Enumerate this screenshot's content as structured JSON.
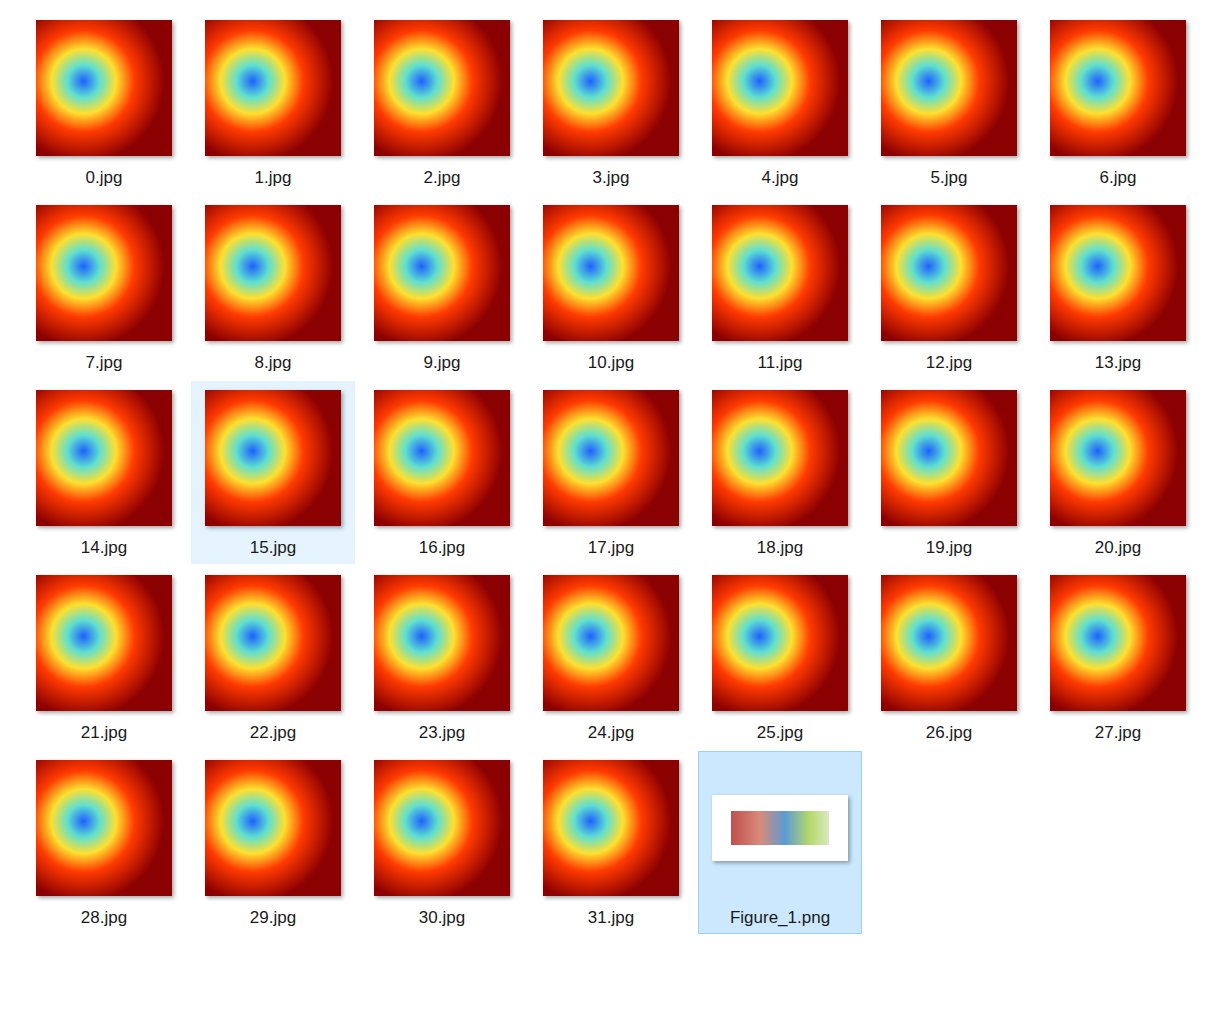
{
  "files": [
    {
      "name": "0.jpg",
      "kind": "image",
      "selected": false,
      "hovered": false
    },
    {
      "name": "1.jpg",
      "kind": "image",
      "selected": false,
      "hovered": false
    },
    {
      "name": "2.jpg",
      "kind": "image",
      "selected": false,
      "hovered": false
    },
    {
      "name": "3.jpg",
      "kind": "image",
      "selected": false,
      "hovered": false
    },
    {
      "name": "4.jpg",
      "kind": "image",
      "selected": false,
      "hovered": false
    },
    {
      "name": "5.jpg",
      "kind": "image",
      "selected": false,
      "hovered": false
    },
    {
      "name": "6.jpg",
      "kind": "image",
      "selected": false,
      "hovered": false
    },
    {
      "name": "7.jpg",
      "kind": "image",
      "selected": false,
      "hovered": false
    },
    {
      "name": "8.jpg",
      "kind": "image",
      "selected": false,
      "hovered": false
    },
    {
      "name": "9.jpg",
      "kind": "image",
      "selected": false,
      "hovered": false
    },
    {
      "name": "10.jpg",
      "kind": "image",
      "selected": false,
      "hovered": false
    },
    {
      "name": "11.jpg",
      "kind": "image",
      "selected": false,
      "hovered": false
    },
    {
      "name": "12.jpg",
      "kind": "image",
      "selected": false,
      "hovered": false
    },
    {
      "name": "13.jpg",
      "kind": "image",
      "selected": false,
      "hovered": false
    },
    {
      "name": "14.jpg",
      "kind": "image",
      "selected": false,
      "hovered": false
    },
    {
      "name": "15.jpg",
      "kind": "image",
      "selected": false,
      "hovered": true
    },
    {
      "name": "16.jpg",
      "kind": "image",
      "selected": false,
      "hovered": false
    },
    {
      "name": "17.jpg",
      "kind": "image",
      "selected": false,
      "hovered": false
    },
    {
      "name": "18.jpg",
      "kind": "image",
      "selected": false,
      "hovered": false
    },
    {
      "name": "19.jpg",
      "kind": "image",
      "selected": false,
      "hovered": false
    },
    {
      "name": "20.jpg",
      "kind": "image",
      "selected": false,
      "hovered": false
    },
    {
      "name": "21.jpg",
      "kind": "image",
      "selected": false,
      "hovered": false
    },
    {
      "name": "22.jpg",
      "kind": "image",
      "selected": false,
      "hovered": false
    },
    {
      "name": "23.jpg",
      "kind": "image",
      "selected": false,
      "hovered": false
    },
    {
      "name": "24.jpg",
      "kind": "image",
      "selected": false,
      "hovered": false
    },
    {
      "name": "25.jpg",
      "kind": "image",
      "selected": false,
      "hovered": false
    },
    {
      "name": "26.jpg",
      "kind": "image",
      "selected": false,
      "hovered": false
    },
    {
      "name": "27.jpg",
      "kind": "image",
      "selected": false,
      "hovered": false
    },
    {
      "name": "28.jpg",
      "kind": "image",
      "selected": false,
      "hovered": false
    },
    {
      "name": "29.jpg",
      "kind": "image",
      "selected": false,
      "hovered": false
    },
    {
      "name": "30.jpg",
      "kind": "image",
      "selected": false,
      "hovered": false
    },
    {
      "name": "31.jpg",
      "kind": "image",
      "selected": false,
      "hovered": false
    },
    {
      "name": "Figure_1.png",
      "kind": "figure",
      "selected": true,
      "hovered": false
    }
  ]
}
